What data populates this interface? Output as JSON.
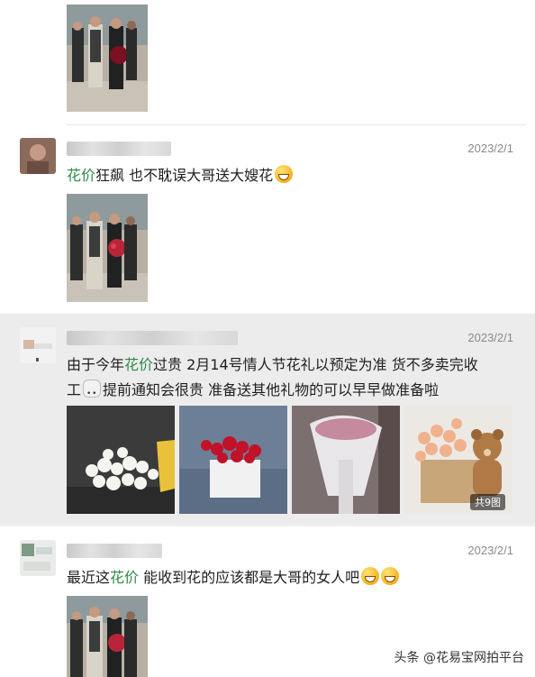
{
  "posts": [
    {
      "date": "",
      "text": []
    },
    {
      "date": "2023/2/1",
      "keyword": "花价",
      "text_after": "狂飙 也不耽误大哥送大嫂花"
    },
    {
      "date": "2023/2/1",
      "line1_pre": "由于今年",
      "keyword": "花价",
      "line1_post": "过贵 2月14号情人节花礼以预定为准 货不多卖完收",
      "line2_pre": "工",
      "line2_post": "提前通知会很贵 准备送其他礼物的可以早早做准备啦",
      "image_count_badge": "共9图"
    },
    {
      "date": "2023/2/1",
      "text_pre": "最近这",
      "keyword": "花价",
      "text_after": " 能收到花的应该都是大哥的女人吧"
    }
  ],
  "watermark": "头条 @花易宝网拍平台",
  "colors": {
    "keyword": "#2c8a47",
    "date": "#8a8a8a",
    "highlight_bg": "#ececec"
  }
}
